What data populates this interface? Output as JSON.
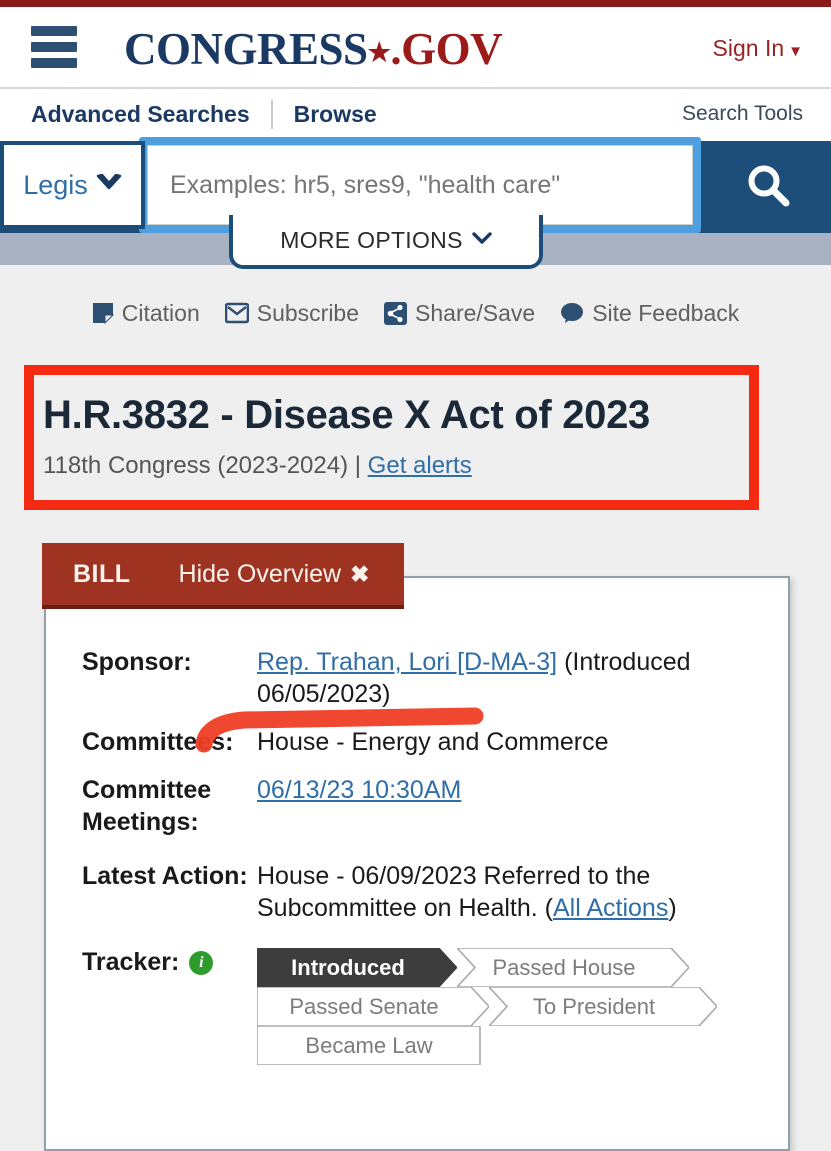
{
  "colors": {
    "brand_blue": "#1d4e79",
    "brand_red": "#9b1b1b",
    "annotation_red": "#f42b12",
    "bill_tab_red": "#9e3322",
    "link_blue": "#2f6ea8",
    "tracker_active": "#3d3d3d",
    "info_green": "#2d9c2d"
  },
  "header": {
    "menu_icon": "hamburger-icon",
    "logo_part1": "CONGRESS",
    "logo_star": "★",
    "logo_part2": ".GOV",
    "sign_in": "Sign In",
    "sign_in_caret": "▼"
  },
  "nav": {
    "advanced_searches": "Advanced Searches",
    "browse": "Browse",
    "search_tools": "Search Tools"
  },
  "search": {
    "scope_label": "Legis",
    "scope_caret": "❯",
    "placeholder": "Examples: hr5, sres9, \"health care\"",
    "value": "",
    "search_icon": "magnifier-icon",
    "more_options": "MORE OPTIONS",
    "more_options_caret": "❯"
  },
  "utility_links": [
    {
      "label": "Citation",
      "icon": "citation-icon"
    },
    {
      "label": "Subscribe",
      "icon": "envelope-icon"
    },
    {
      "label": "Share/Save",
      "icon": "share-icon"
    },
    {
      "label": "Site Feedback",
      "icon": "speech-bubble-icon"
    }
  ],
  "bill": {
    "title": "H.R.3832 - Disease X Act of 2023",
    "congress": "118th Congress (2023-2024)",
    "separator": "|",
    "get_alerts": "Get alerts"
  },
  "overview": {
    "tab_label": "BILL",
    "hide_overview": "Hide Overview",
    "hide_overview_x": "✖",
    "rows": [
      {
        "key": "Sponsor:",
        "link": "Rep. Trahan, Lori [D-MA-3]",
        "text": " (Introduced 06/05/2023)"
      },
      {
        "key": "Committees:",
        "text": "House - Energy and Commerce"
      },
      {
        "key": "Committee Meetings:",
        "link": "06/13/23 10:30AM",
        "text": ""
      },
      {
        "key": "Latest Action:",
        "text_before": "House - 06/09/2023 Referred to the Subcommittee on Health.  (",
        "link": "All Actions",
        "text_after": ")"
      }
    ],
    "tracker": {
      "key": "Tracker:",
      "info_icon": "info-icon",
      "steps": [
        {
          "label": "Introduced",
          "active": true
        },
        {
          "label": "Passed House",
          "active": false
        },
        {
          "label": "Passed Senate",
          "active": false
        },
        {
          "label": "To President",
          "active": false
        },
        {
          "label": "Became Law",
          "active": false
        }
      ]
    }
  },
  "annotations": {
    "title_highlight_box": "red-rectangle-around-bill-title",
    "underline_stroke": "red-underline-under-sponsor-line"
  }
}
